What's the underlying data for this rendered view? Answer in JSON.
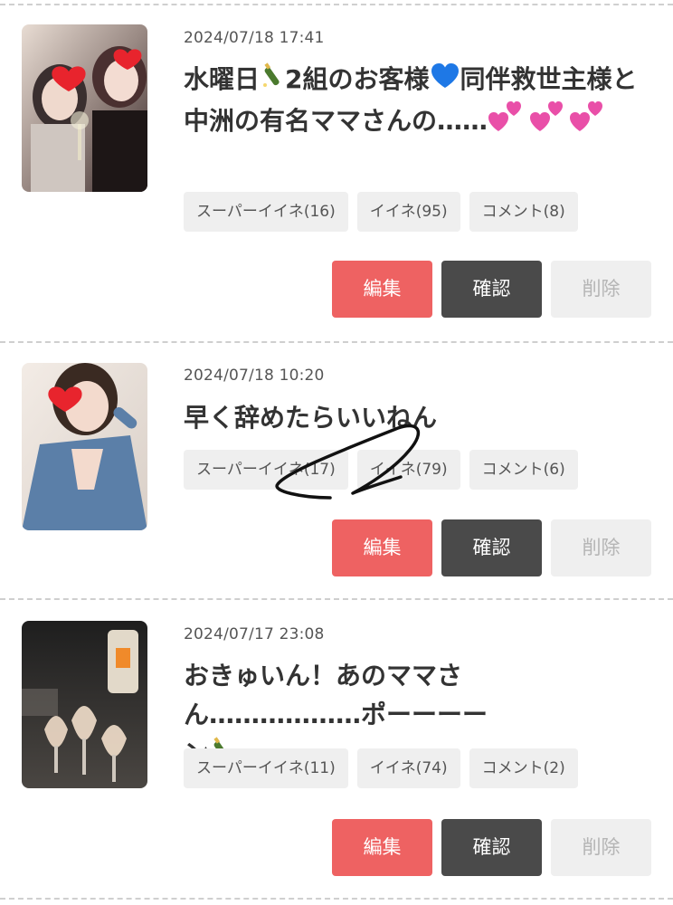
{
  "posts": [
    {
      "date": "2024/07/18 17:41",
      "title_parts": [
        "水曜日",
        "2組のお客様",
        "同伴救世主様と中洲の有名ママさんの……"
      ],
      "icons": [
        "champagne-icon",
        "blue-heart-icon",
        "two-hearts-icon"
      ],
      "tags": [
        "スーパーイイネ(16)",
        "イイネ(95)",
        "コメント(8)"
      ],
      "buttons": {
        "edit": "編集",
        "check": "確認",
        "delete": "削除"
      },
      "thumb_colors": [
        "#6a4a4a",
        "#f1d6d6"
      ]
    },
    {
      "date": "2024/07/18 10:20",
      "title": "早く辞めたらいいねん",
      "tags": [
        "スーパーイイネ(17)",
        "イイネ(79)",
        "コメント(6)"
      ],
      "buttons": {
        "edit": "編集",
        "check": "確認",
        "delete": "削除"
      },
      "thumb_colors": [
        "#5b7fa8",
        "#efe4dc"
      ]
    },
    {
      "date": "2024/07/17 23:08",
      "title_parts": [
        "おきゅいん！あのママさん………………ポーーーーン"
      ],
      "icons": [
        "champagne-icon"
      ],
      "tags": [
        "スーパーイイネ(11)",
        "イイネ(74)",
        "コメント(2)"
      ],
      "buttons": {
        "edit": "編集",
        "check": "確認",
        "delete": "削除"
      },
      "thumb_colors": [
        "#2b2b2b",
        "#f0e6d8"
      ]
    }
  ],
  "colors": {
    "edit": "#ee6262",
    "check": "#4a4a4a",
    "delete_bg": "#efefef",
    "tag_bg": "#efefef",
    "heart": "#e8242d",
    "blue_heart": "#1e78e6",
    "pink_heart": "#e94fa8"
  }
}
